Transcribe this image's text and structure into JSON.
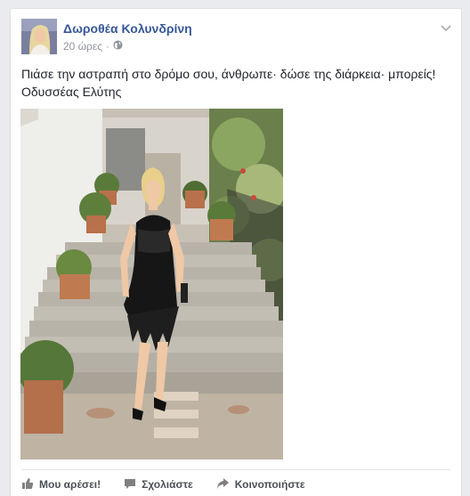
{
  "post": {
    "author": "Δωροθέα Κολυνδρίνη",
    "time": "20 ώρες",
    "separator": "·",
    "text_line1": "Πιάσε την αστραπή στο δρόμο σου, άνθρωπε· δώσε της διάρκεια· μπορείς!",
    "text_line2": "Οδυσσέας Ελύτης"
  },
  "actions": {
    "like": "Μου αρέσει!",
    "comment": "Σχολιάστε",
    "share": "Κοινοποιήστε"
  },
  "icons": {
    "audience": "globe-icon",
    "menu": "chevron-down-icon",
    "like": "thumbs-up-icon",
    "comment": "speech-bubble-icon",
    "share": "share-arrow-icon"
  },
  "colors": {
    "author_link": "#365899",
    "meta_text": "#90949c",
    "action_text": "#4b4f56",
    "page_bg": "#e9ebee"
  }
}
